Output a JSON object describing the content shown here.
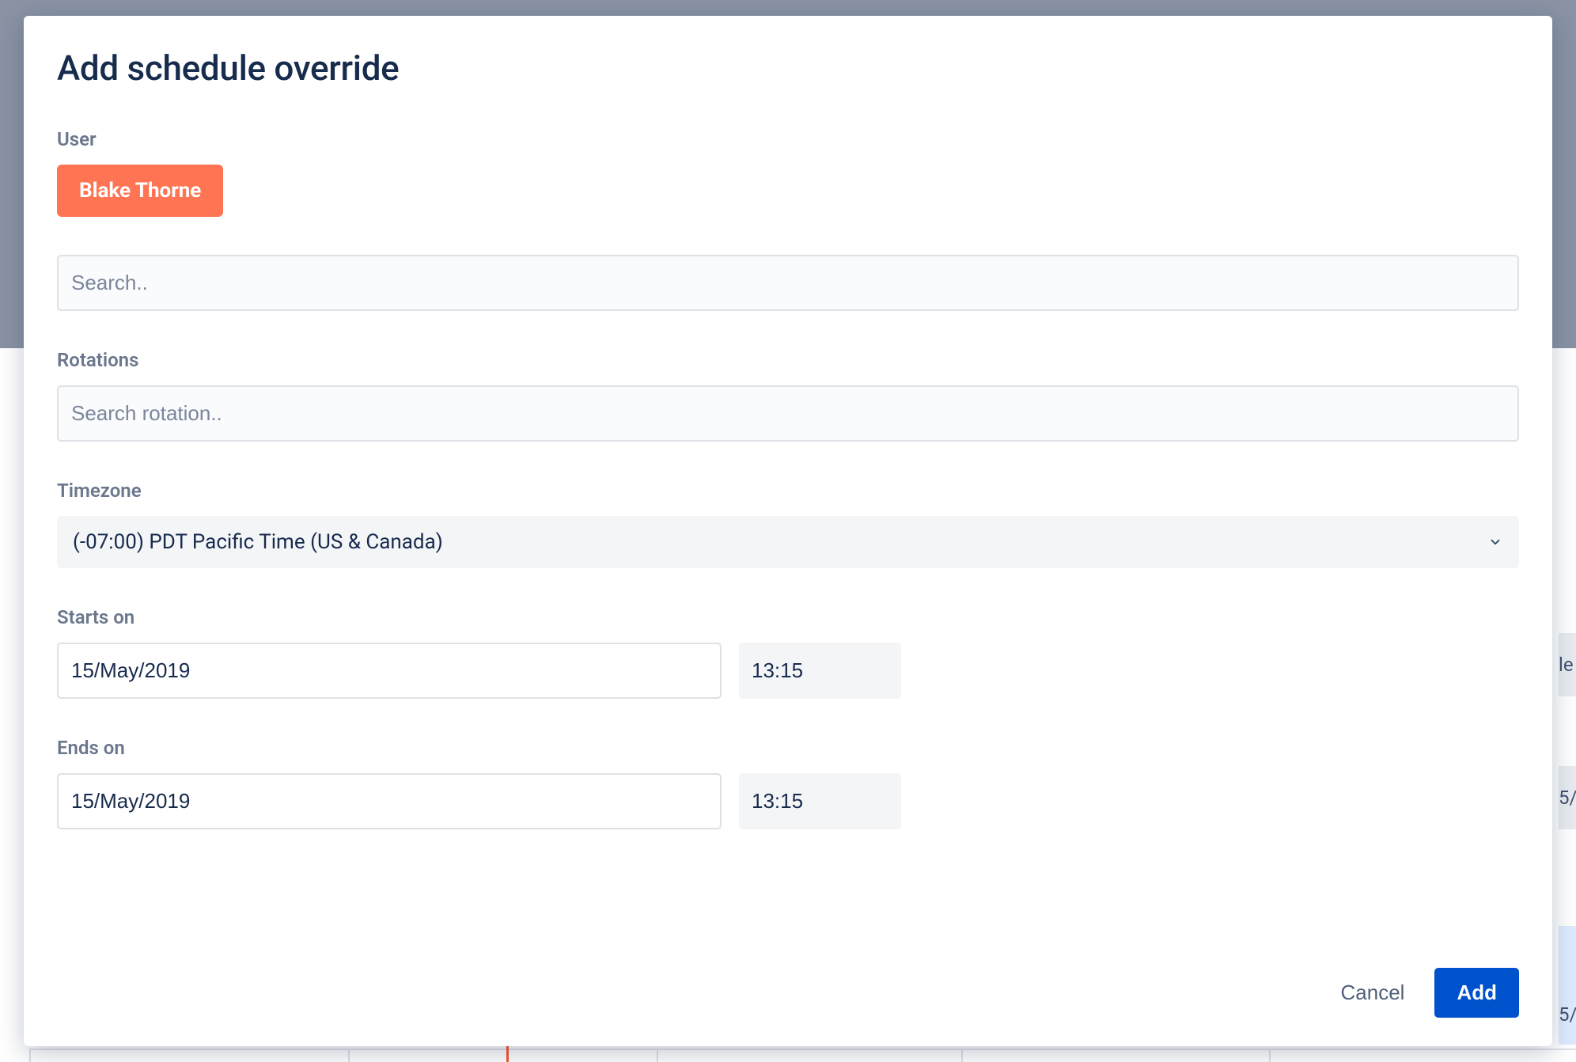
{
  "modal": {
    "title": "Add schedule override",
    "user": {
      "label": "User",
      "selected_name": "Blake Thorne",
      "search_placeholder": "Search.."
    },
    "rotations": {
      "label": "Rotations",
      "search_placeholder": "Search rotation.."
    },
    "timezone": {
      "label": "Timezone",
      "value": "(-07:00) PDT Pacific Time (US & Canada)"
    },
    "starts_on": {
      "label": "Starts on",
      "date": "15/May/2019",
      "time": "13:15"
    },
    "ends_on": {
      "label": "Ends on",
      "date": "15/May/2019",
      "time": "13:15"
    },
    "buttons": {
      "cancel": "Cancel",
      "add": "Add"
    }
  },
  "background": {
    "row_a": "le",
    "row_b": "5/",
    "row_c": "5/"
  }
}
